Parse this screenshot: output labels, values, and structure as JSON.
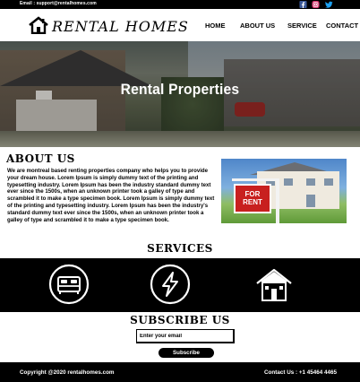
{
  "topbar": {
    "email": "Email : support@rentalhomes.com",
    "social": [
      "facebook-icon",
      "instagram-icon",
      "twitter-icon"
    ]
  },
  "brand": {
    "name": "RENTAL HOMES"
  },
  "nav": {
    "items": [
      "HOME",
      "ABOUT US",
      "SERVICE",
      "CONTACT"
    ]
  },
  "hero": {
    "title": "Rental Properties"
  },
  "about": {
    "title": "ABOUT US",
    "text": "We are montreal based renting properties company who helps you to provide your dream house. Lorem Ipsum is simply dummy text of the printing and typesetting industry. Lorem Ipsum has been the industry standard dummy text ever since the 1500s, when an unknown printer took a galley of type and scrambled it to make a type specimen book. Lorem Ipsum is simply dummy text of the printing and typesetting industry. Lorem Ipsum has been the industry's standard dummy text ever since the 1500s, when an unknown printer took a galley of type and scrambled it to make a type specimen book.",
    "sign_text": "FOR RENT"
  },
  "services": {
    "title": "SERVICES",
    "icons": [
      "bed-icon",
      "lightning-icon",
      "house-icon"
    ]
  },
  "subscribe": {
    "title": "SUBSCRIBE US",
    "placeholder": "Enter your email",
    "button": "Subscribe"
  },
  "footer": {
    "copyright": "Copyright @2020 rentalhomes.com",
    "contact": "Contact Us : +1 45464 4465"
  },
  "colors": {
    "background": "#ffffff",
    "dark": "#000000",
    "facebook": "#3b5998",
    "instagram": "#d6336c",
    "twitter": "#1da1f2",
    "sign_red": "#c8201f"
  }
}
